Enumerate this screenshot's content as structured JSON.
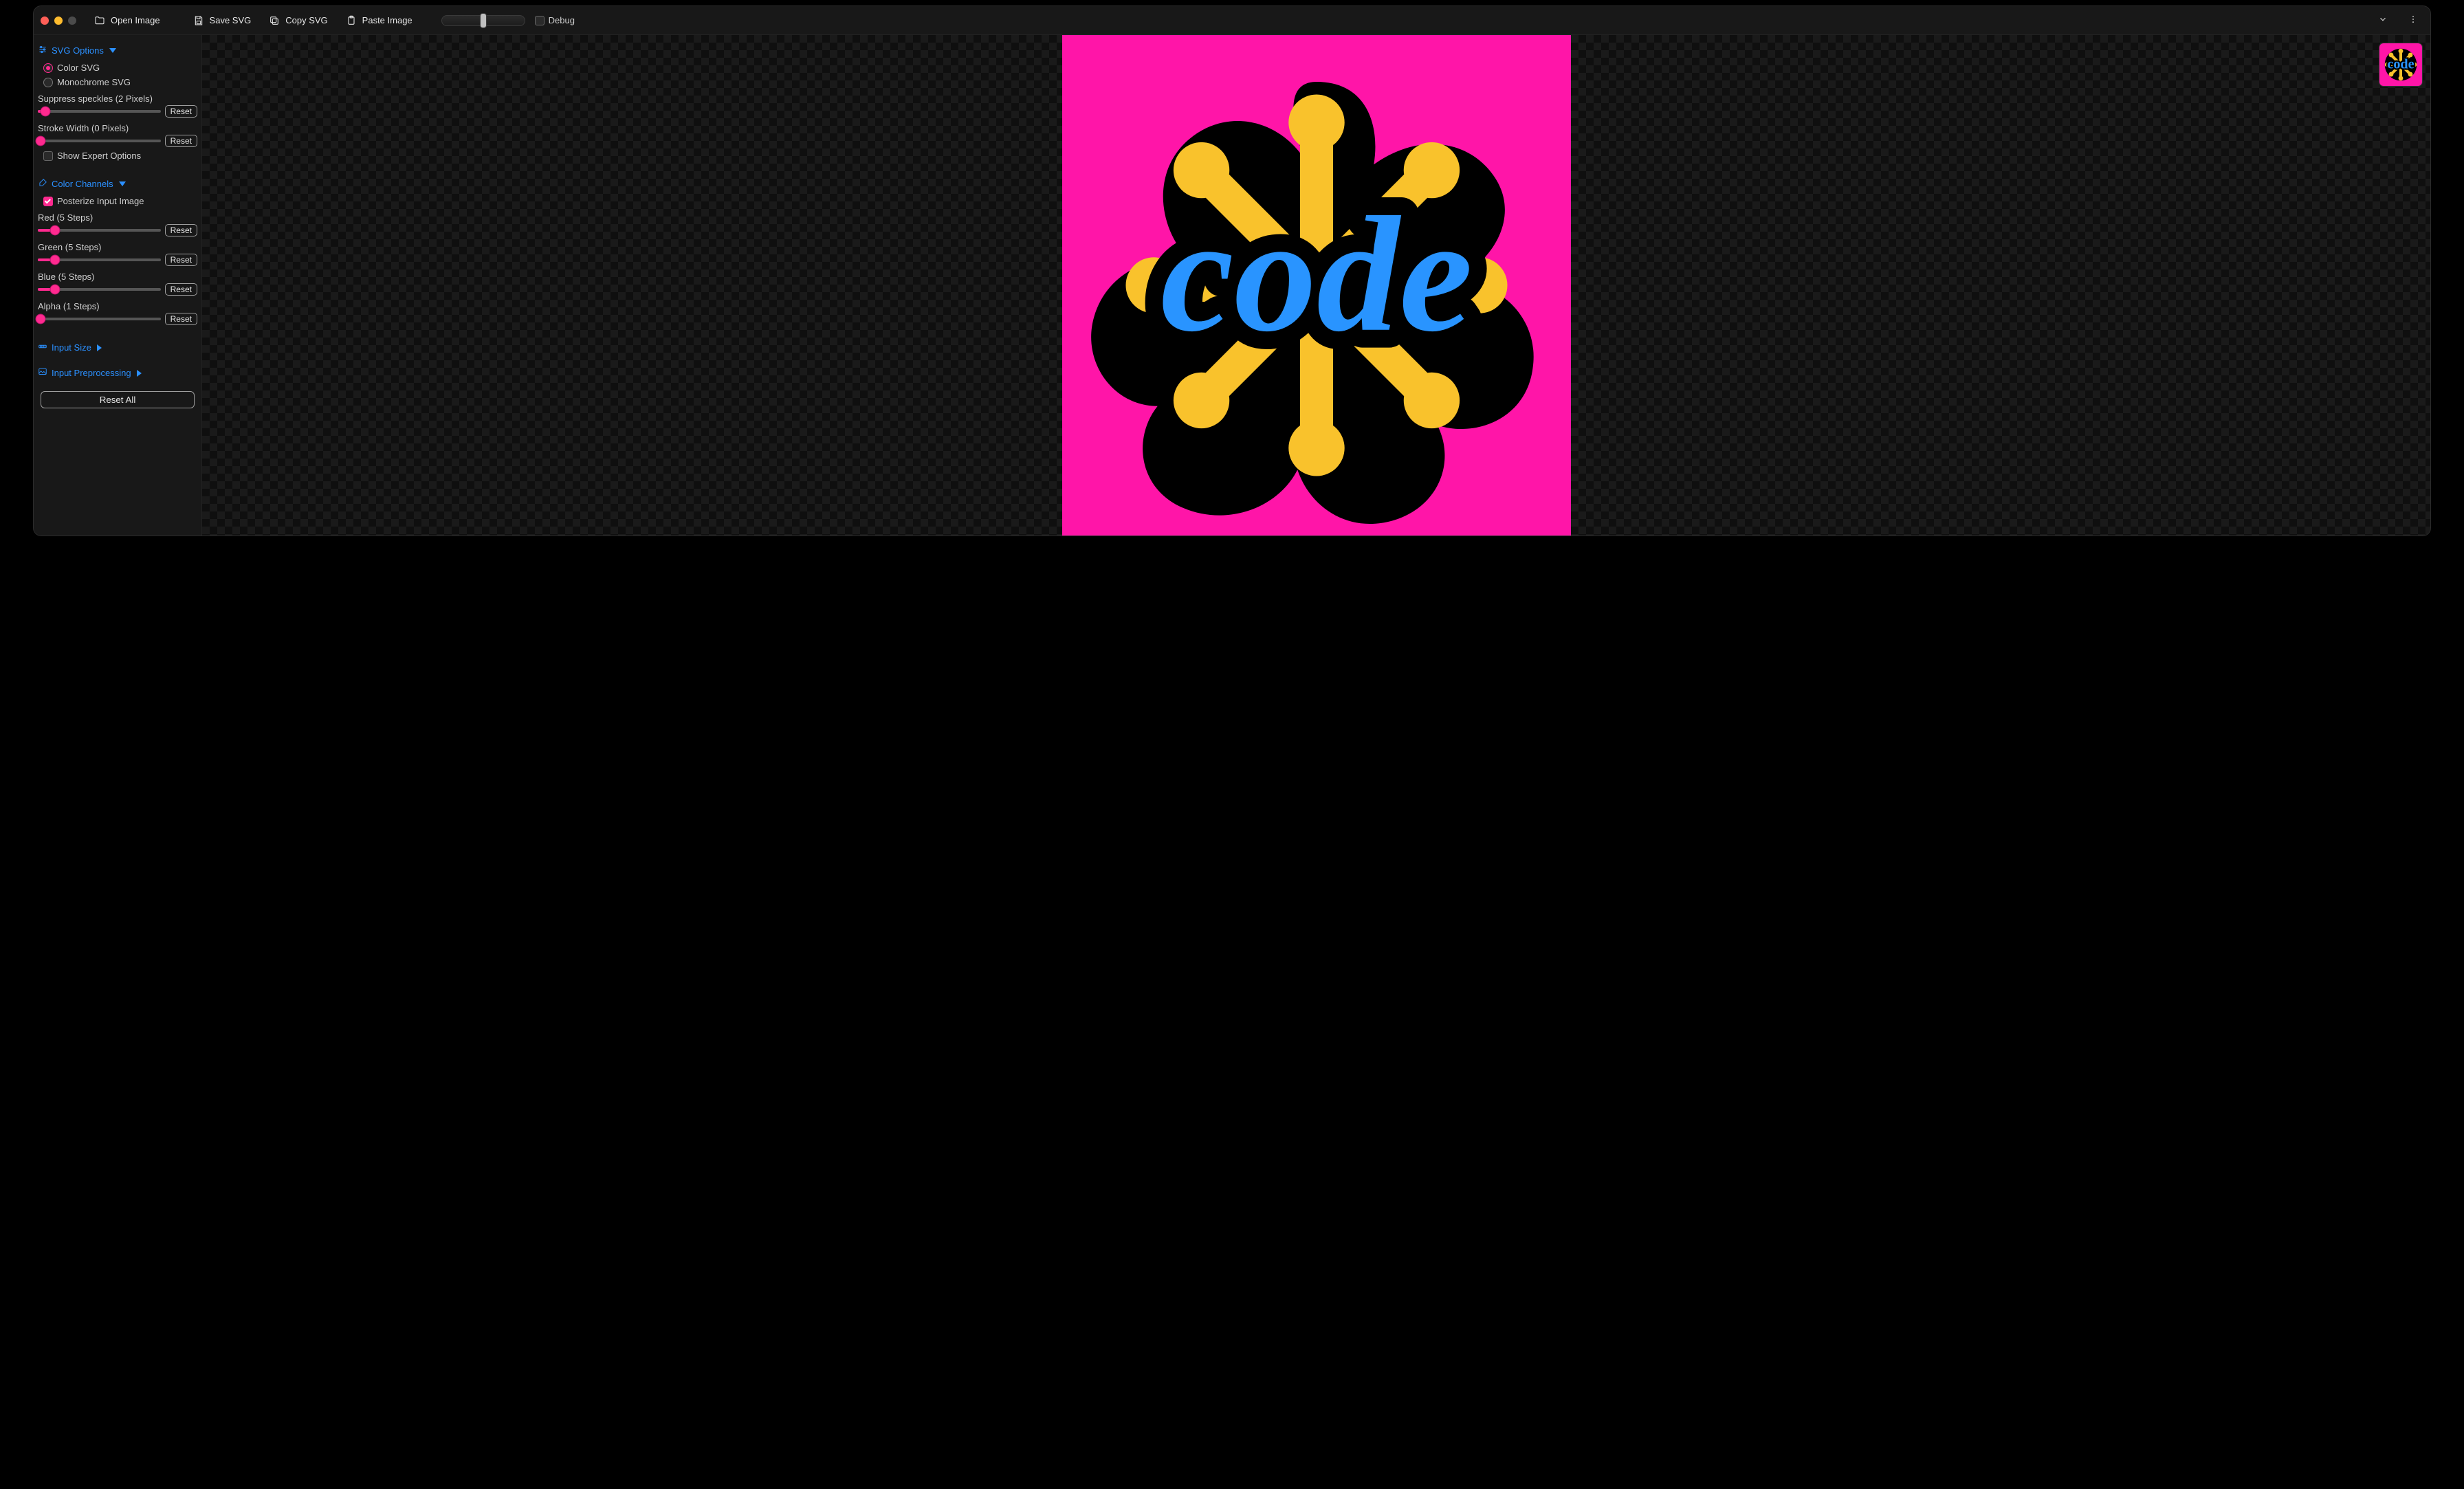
{
  "toolbar": {
    "open_label": "Open Image",
    "save_label": "Save SVG",
    "copy_label": "Copy SVG",
    "paste_label": "Paste Image",
    "debug_label": "Debug",
    "debug_checked": false
  },
  "sidebar": {
    "svg_options": {
      "title": "SVG Options",
      "expanded": true,
      "mode": {
        "color_label": "Color SVG",
        "mono_label": "Monochrome SVG",
        "selected": "color"
      },
      "speckles": {
        "label": "Suppress speckles (2 Pixels)",
        "value": 2,
        "min": 0,
        "max": 50,
        "reset": "Reset"
      },
      "stroke": {
        "label": "Stroke Width (0 Pixels)",
        "value": 0,
        "min": 0,
        "max": 50,
        "reset": "Reset"
      },
      "expert": {
        "label": "Show Expert Options",
        "checked": false
      }
    },
    "color_channels": {
      "title": "Color Channels",
      "expanded": true,
      "posterize": {
        "label": "Posterize Input Image",
        "checked": true
      },
      "red": {
        "label": "Red (5 Steps)",
        "value": 5,
        "min": 1,
        "max": 32,
        "reset": "Reset"
      },
      "green": {
        "label": "Green (5 Steps)",
        "value": 5,
        "min": 1,
        "max": 32,
        "reset": "Reset"
      },
      "blue": {
        "label": "Blue (5 Steps)",
        "value": 5,
        "min": 1,
        "max": 32,
        "reset": "Reset"
      },
      "alpha": {
        "label": "Alpha (1 Steps)",
        "value": 1,
        "min": 1,
        "max": 32,
        "reset": "Reset"
      }
    },
    "input_size": {
      "title": "Input Size",
      "expanded": false
    },
    "input_preprocessing": {
      "title": "Input Preprocessing",
      "expanded": false
    },
    "reset_all_label": "Reset All"
  },
  "colors": {
    "accent_blue": "#2b90ff",
    "accent_pink": "#ff2a8f",
    "artwork_bg": "#ff15a8",
    "artwork_yellow": "#f9c22c",
    "artwork_blue": "#2994ff"
  }
}
